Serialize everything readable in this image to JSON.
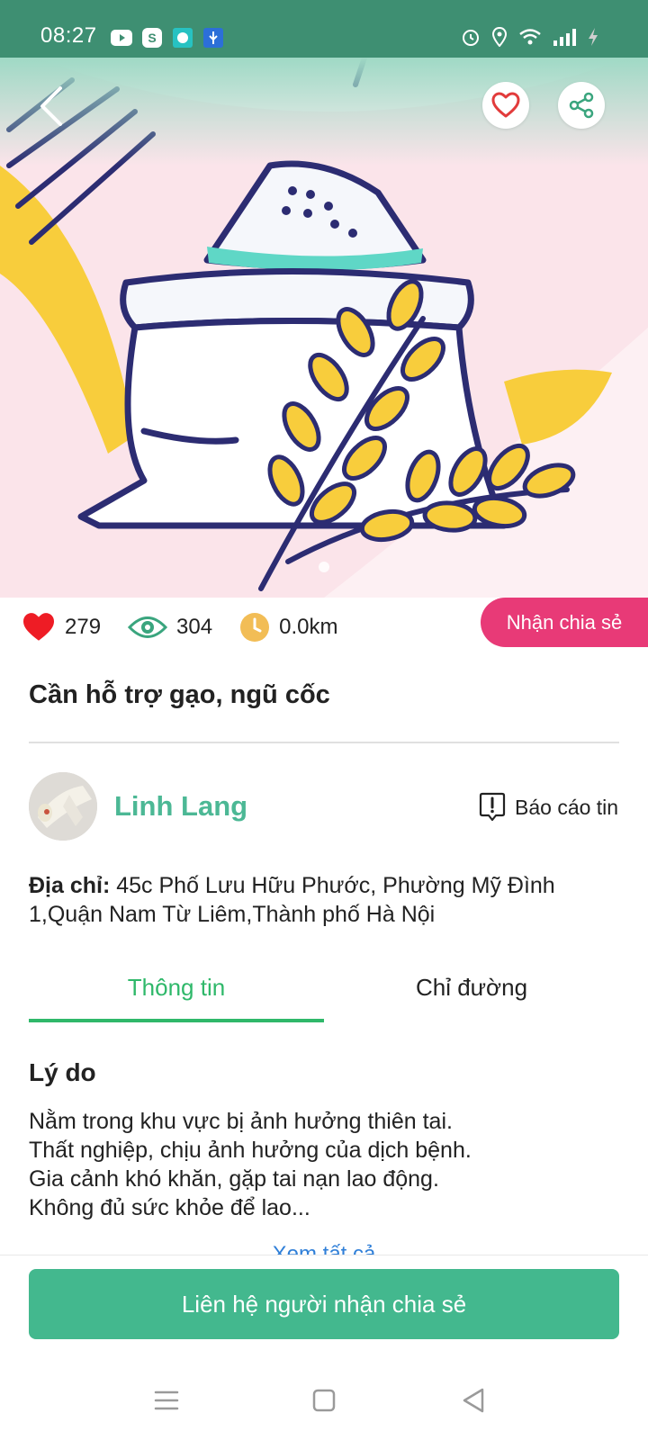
{
  "status_bar": {
    "time": "08:27"
  },
  "actions": {
    "favorite_icon": "heart-icon",
    "share_icon": "share-icon",
    "back_icon": "chevron-left-icon"
  },
  "stats": {
    "likes": "279",
    "views": "304",
    "distance": "0.0km"
  },
  "receive_badge": "Nhận chia sẻ",
  "post_title": "Cần hỗ trợ gạo, ngũ cốc",
  "user": {
    "name": "Linh Lang"
  },
  "report_label": "Báo cáo tin",
  "address": {
    "label": "Địa chỉ:",
    "value": "45c Phố Lưu Hữu Phước, Phường Mỹ Đình 1,Quận Nam Từ Liêm,Thành phố Hà Nội"
  },
  "tabs": [
    {
      "label": "Thông tin"
    },
    {
      "label": "Chỉ đường"
    }
  ],
  "reason": {
    "heading": "Lý do",
    "lines": [
      "Nằm trong khu vực bị ảnh hưởng thiên tai.",
      "Thất nghiệp, chịu ảnh hưởng của dịch bệnh.",
      "Gia cảnh khó khăn, gặp tai nạn lao động.",
      "Không đủ sức khỏe để lao..."
    ],
    "see_all": "Xem tất cả"
  },
  "contact_button": "Liên hệ người nhận chia sẻ",
  "colors": {
    "accent_green": "#43b88e",
    "tab_green": "#2fb86a",
    "pink": "#e83a77",
    "status_bar": "#3e8f72"
  }
}
